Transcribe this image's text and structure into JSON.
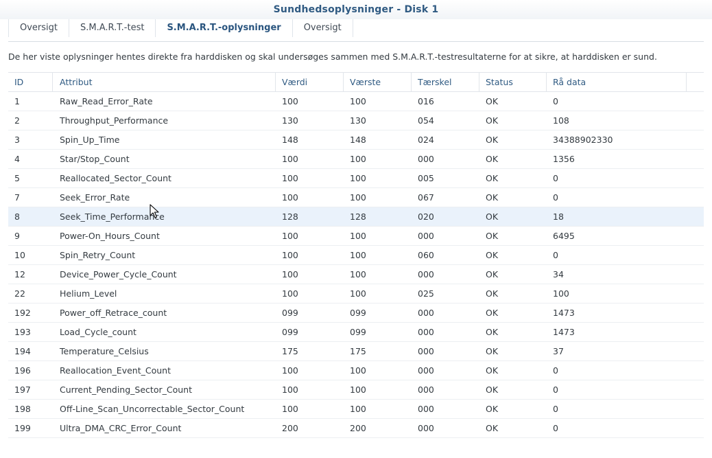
{
  "window": {
    "title": "Sundhedsoplysninger - Disk 1"
  },
  "tabs": [
    {
      "label": "Oversigt",
      "active": false
    },
    {
      "label": "S.M.A.R.T.-test",
      "active": false
    },
    {
      "label": "S.M.A.R.T.-oplysninger",
      "active": true
    },
    {
      "label": "Oversigt",
      "active": false
    }
  ],
  "description": "De her viste oplysninger hentes direkte fra harddisken og skal undersøges sammen med S.M.A.R.T.-testresultaterne for at sikre, at harddisken er sund.",
  "table": {
    "columns": [
      "ID",
      "Attribut",
      "Værdi",
      "Værste",
      "Tærskel",
      "Status",
      "Rå data"
    ],
    "rows": [
      {
        "id": "1",
        "attr": "Raw_Read_Error_Rate",
        "value": "100",
        "worst": "100",
        "threshold": "016",
        "status": "OK",
        "raw": "0"
      },
      {
        "id": "2",
        "attr": "Throughput_Performance",
        "value": "130",
        "worst": "130",
        "threshold": "054",
        "status": "OK",
        "raw": "108"
      },
      {
        "id": "3",
        "attr": "Spin_Up_Time",
        "value": "148",
        "worst": "148",
        "threshold": "024",
        "status": "OK",
        "raw": "34388902330"
      },
      {
        "id": "4",
        "attr": "Star/Stop_Count",
        "value": "100",
        "worst": "100",
        "threshold": "000",
        "status": "OK",
        "raw": "1356"
      },
      {
        "id": "5",
        "attr": "Reallocated_Sector_Count",
        "value": "100",
        "worst": "100",
        "threshold": "005",
        "status": "OK",
        "raw": "0"
      },
      {
        "id": "7",
        "attr": "Seek_Error_Rate",
        "value": "100",
        "worst": "100",
        "threshold": "067",
        "status": "OK",
        "raw": "0"
      },
      {
        "id": "8",
        "attr": "Seek_Time_Performance",
        "value": "128",
        "worst": "128",
        "threshold": "020",
        "status": "OK",
        "raw": "18"
      },
      {
        "id": "9",
        "attr": "Power-On_Hours_Count",
        "value": "100",
        "worst": "100",
        "threshold": "000",
        "status": "OK",
        "raw": "6495"
      },
      {
        "id": "10",
        "attr": "Spin_Retry_Count",
        "value": "100",
        "worst": "100",
        "threshold": "060",
        "status": "OK",
        "raw": "0"
      },
      {
        "id": "12",
        "attr": "Device_Power_Cycle_Count",
        "value": "100",
        "worst": "100",
        "threshold": "000",
        "status": "OK",
        "raw": "34"
      },
      {
        "id": "22",
        "attr": "Helium_Level",
        "value": "100",
        "worst": "100",
        "threshold": "025",
        "status": "OK",
        "raw": "100"
      },
      {
        "id": "192",
        "attr": "Power_off_Retrace_count",
        "value": "099",
        "worst": "099",
        "threshold": "000",
        "status": "OK",
        "raw": "1473"
      },
      {
        "id": "193",
        "attr": "Load_Cycle_count",
        "value": "099",
        "worst": "099",
        "threshold": "000",
        "status": "OK",
        "raw": "1473"
      },
      {
        "id": "194",
        "attr": "Temperature_Celsius",
        "value": "175",
        "worst": "175",
        "threshold": "000",
        "status": "OK",
        "raw": "37"
      },
      {
        "id": "196",
        "attr": "Reallocation_Event_Count",
        "value": "100",
        "worst": "100",
        "threshold": "000",
        "status": "OK",
        "raw": "0"
      },
      {
        "id": "197",
        "attr": "Current_Pending_Sector_Count",
        "value": "100",
        "worst": "100",
        "threshold": "000",
        "status": "OK",
        "raw": "0"
      },
      {
        "id": "198",
        "attr": "Off-Line_Scan_Uncorrectable_Sector_Count",
        "value": "100",
        "worst": "100",
        "threshold": "000",
        "status": "OK",
        "raw": "0"
      },
      {
        "id": "199",
        "attr": "Ultra_DMA_CRC_Error_Count",
        "value": "200",
        "worst": "200",
        "threshold": "000",
        "status": "OK",
        "raw": "0"
      }
    ],
    "highlighted_row_id": "8"
  },
  "colors": {
    "title": "#2f5a82",
    "active_tab": "#2a557f",
    "header_text": "#2f5a82",
    "row_highlight": "#eaf2fb"
  },
  "cursor": {
    "icon": "mouse-pointer-icon"
  }
}
